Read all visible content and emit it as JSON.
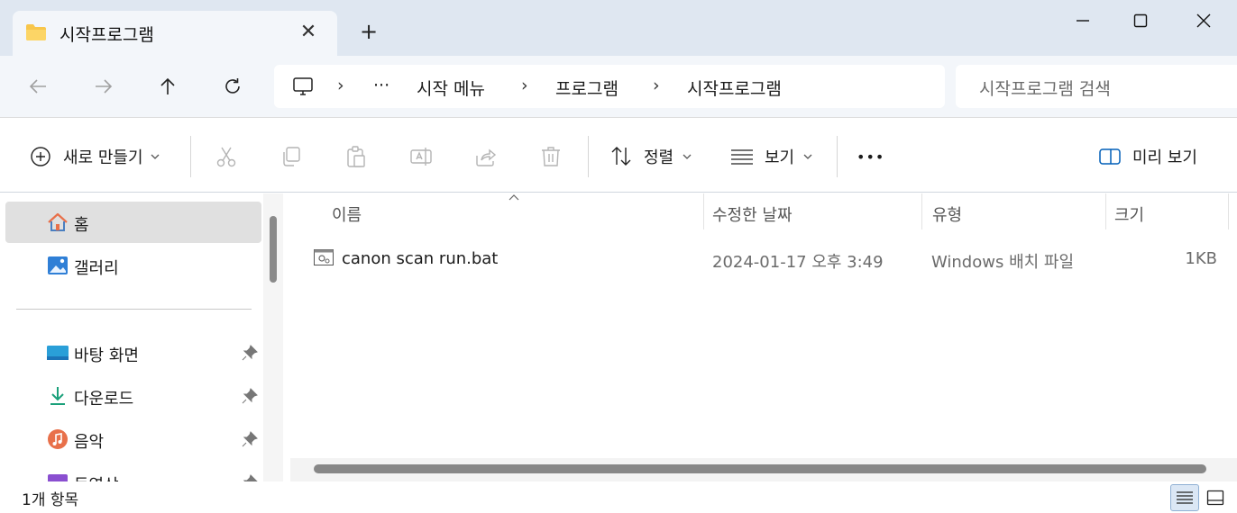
{
  "tab": {
    "title": "시작프로그램",
    "close": "✕",
    "new_tab": "+"
  },
  "window": {
    "minimize": "minimize",
    "maximize": "maximize",
    "close": "close"
  },
  "breadcrumb": {
    "more": "···",
    "separator": "›",
    "items": [
      "시작 메뉴",
      "프로그램",
      "시작프로그램"
    ]
  },
  "search": {
    "placeholder": "시작프로그램 검색"
  },
  "toolbar": {
    "new_label": "새로 만들기",
    "sort_label": "정렬",
    "view_label": "보기",
    "more": "•••",
    "preview_label": "미리 보기"
  },
  "sidebar": {
    "items": [
      {
        "label": "홈",
        "icon": "home-icon",
        "selected": true
      },
      {
        "label": "갤러리",
        "icon": "gallery-icon",
        "selected": false
      }
    ],
    "pinned": [
      {
        "label": "바탕 화면",
        "icon": "desktop-icon",
        "pinned": true
      },
      {
        "label": "다운로드",
        "icon": "download-icon",
        "pinned": true
      },
      {
        "label": "음악",
        "icon": "music-icon",
        "pinned": true
      },
      {
        "label": "동영상",
        "icon": "video-icon",
        "pinned": true
      }
    ]
  },
  "columns": {
    "name": "이름",
    "modified": "수정한 날짜",
    "type": "유형",
    "size": "크기"
  },
  "files": [
    {
      "name": "canon scan run.bat",
      "modified": "2024-01-17 오후 3:49",
      "type": "Windows 배치 파일",
      "size": "1KB"
    }
  ],
  "status": {
    "count": "1개 항목"
  },
  "colors": {
    "accent": "#005fb8",
    "titlebar": "#dfe7f1",
    "selected": "#e0e0e0"
  }
}
